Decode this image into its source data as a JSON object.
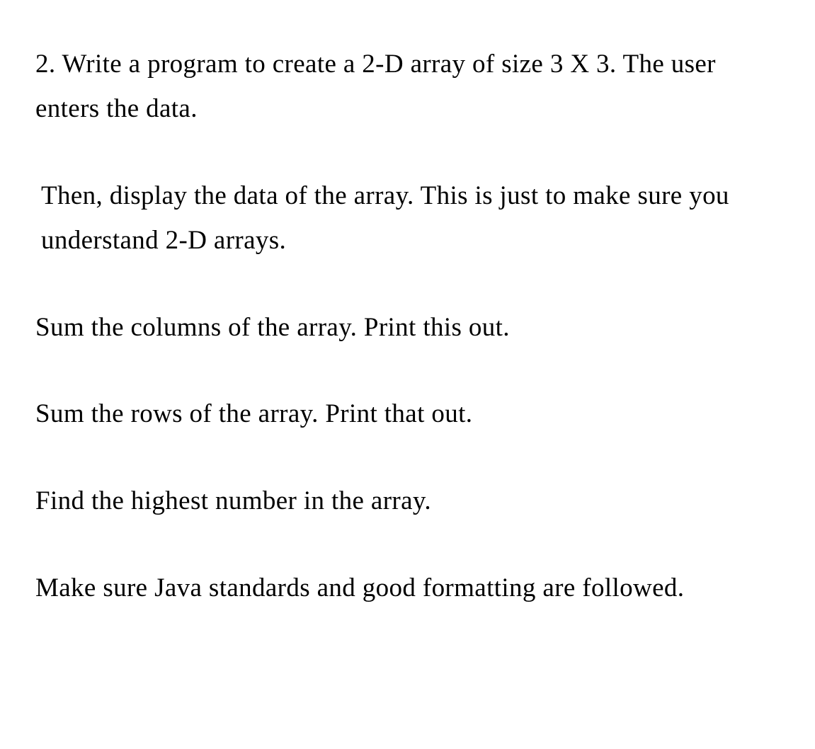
{
  "paragraphs": [
    {
      "text": "2. Write a program to create a 2-D array of size 3 X 3.  The user enters the data.",
      "indent": false
    },
    {
      "text": "  Then, display the data of the array.   This is just to make sure you understand 2-D arrays.",
      "indent": true
    },
    {
      "text": "Sum the  columns of the array.   Print this out.",
      "indent": false
    },
    {
      "text": "Sum the rows of the array.  Print that out.",
      "indent": false
    },
    {
      "text": "Find the highest number in the array.",
      "indent": false
    },
    {
      "text": "Make sure Java standards and good formatting are followed.",
      "indent": false
    }
  ]
}
